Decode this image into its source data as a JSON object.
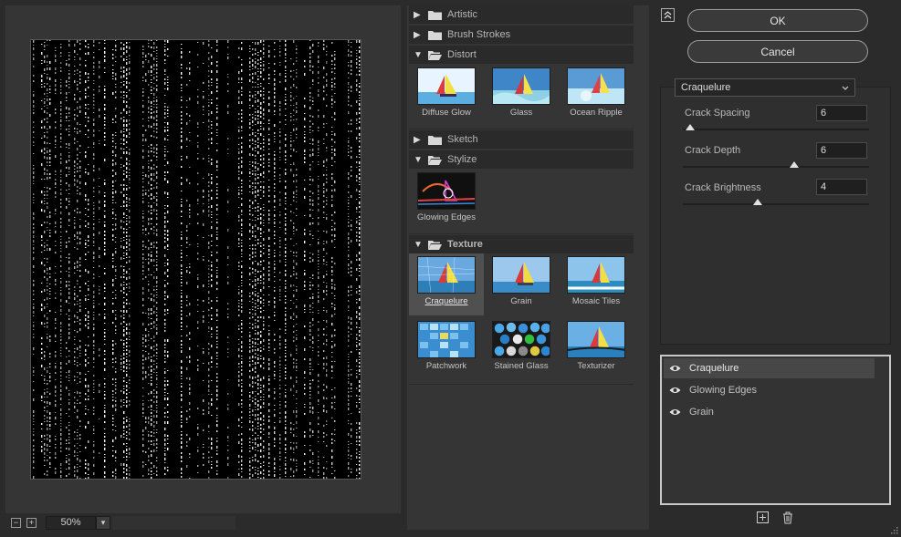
{
  "preview": {
    "zoom_value": "50%",
    "zoom_out_symbol": "−",
    "zoom_in_symbol": "+"
  },
  "gallery": {
    "categories": [
      {
        "name": "Artistic",
        "expanded": false
      },
      {
        "name": "Brush Strokes",
        "expanded": false
      },
      {
        "name": "Distort",
        "expanded": true,
        "filters": [
          "Diffuse Glow",
          "Glass",
          "Ocean Ripple"
        ]
      },
      {
        "name": "Sketch",
        "expanded": false
      },
      {
        "name": "Stylize",
        "expanded": true,
        "filters": [
          "Glowing Edges"
        ]
      },
      {
        "name": "Texture",
        "expanded": true,
        "filters": [
          "Craquelure",
          "Grain",
          "Mosaic Tiles",
          "Patchwork",
          "Stained Glass",
          "Texturizer"
        ]
      }
    ],
    "selected_filter": "Craquelure"
  },
  "dialog": {
    "ok_label": "OK",
    "cancel_label": "Cancel",
    "collapse_icon": "double-chevron-up-icon"
  },
  "settings": {
    "filter_name": "Craquelure",
    "params": [
      {
        "label": "Crack Spacing",
        "value": "6",
        "min": 2,
        "max": 100,
        "position": 0.04
      },
      {
        "label": "Crack Depth",
        "value": "6",
        "min": 0,
        "max": 10,
        "position": 0.6
      },
      {
        "label": "Crack Brightness",
        "value": "4",
        "min": 0,
        "max": 10,
        "position": 0.4
      }
    ]
  },
  "layers": [
    {
      "name": "Craquelure",
      "visible": true,
      "active": true
    },
    {
      "name": "Glowing Edges",
      "visible": true,
      "active": false
    },
    {
      "name": "Grain",
      "visible": true,
      "active": false
    }
  ],
  "colors": {
    "background": "#2b2b2b",
    "panel": "#353535",
    "selection": "#505050"
  }
}
